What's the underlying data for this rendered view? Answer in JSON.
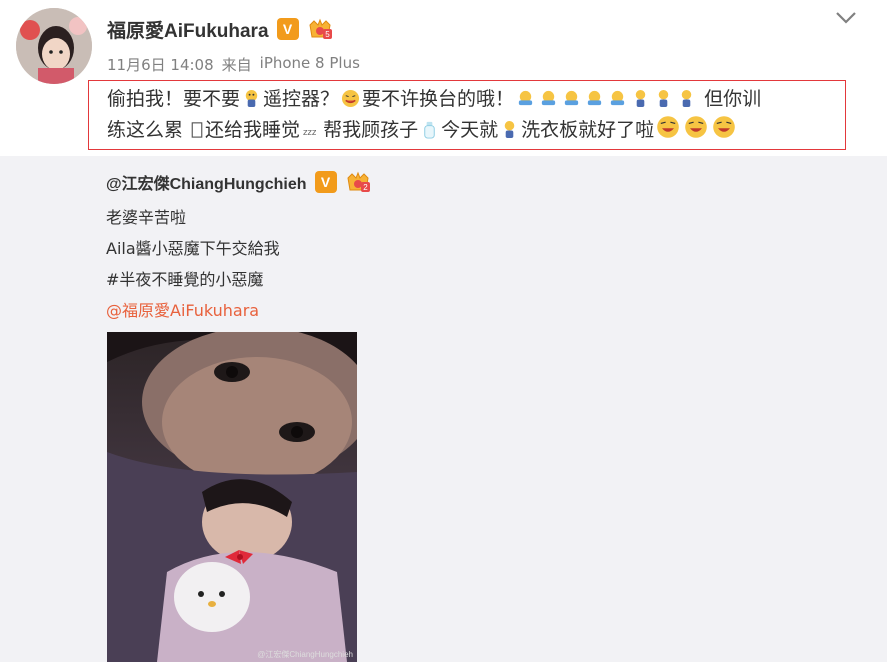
{
  "post": {
    "author": "福原愛AiFukuhara",
    "verified_badge": "V",
    "timestamp": "11月6日 14:08",
    "source_prefix": "来自",
    "source_device": "iPhone 8 Plus",
    "text": {
      "seg1": "偷拍我！要不要",
      "seg2": "遥控器？",
      "seg3": "要不许换台的哦！",
      "seg4": "但你训",
      "seg5": "练这么累 ",
      "seg5b": "还给我睡觉",
      "seg6": "帮我顾孩子",
      "seg7": "今天就",
      "seg8": "洗衣板就好了啦"
    }
  },
  "repost": {
    "author": "@江宏傑ChiangHungchieh",
    "verified_badge": "V",
    "line1": "老婆辛苦啦",
    "line2": "Aila醬小惡魔下午交給我",
    "line3": "#半夜不睡覺的小惡魔",
    "mention": "@福原愛AiFukuhara",
    "photo_watermark": "@江宏傑ChiangHungchieh"
  },
  "colors": {
    "highlight_border": "#e3383b",
    "mention": "#e8613c",
    "verified": "#f29b1b",
    "repost_bg": "#f2f2f5"
  },
  "icons": {
    "more": "chevron-down-icon",
    "remote": "remote-emoji-icon",
    "yum": "yum-face-emoji-icon",
    "hug": "hug-emoji-icon",
    "sleep": "sleep-zzz-emoji-icon",
    "bottle": "baby-bottle-emoji-icon",
    "laugh": "laugh-emoji-icon"
  }
}
